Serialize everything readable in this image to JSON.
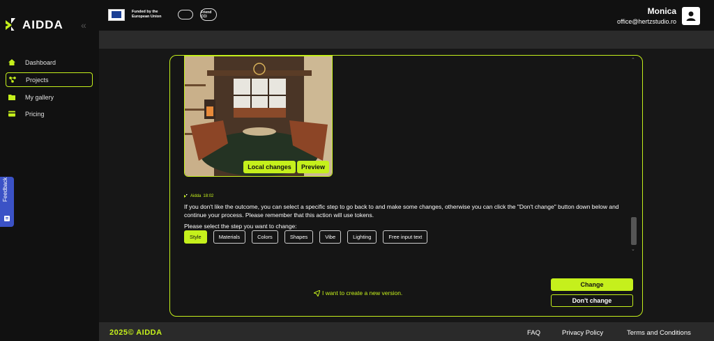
{
  "brand": {
    "name": "AIDDA",
    "accent": "#c5f01c"
  },
  "sponsors": {
    "eu_text": "Funded by the European Union",
    "cci_text": "Friend CCI"
  },
  "user": {
    "name": "Monica",
    "email": "office@hertzstudio.ro"
  },
  "sidebar": {
    "items": [
      {
        "label": "Dashboard",
        "icon": "home-icon",
        "active": false
      },
      {
        "label": "Projects",
        "icon": "projects-icon",
        "active": true
      },
      {
        "label": "My gallery",
        "icon": "folder-icon",
        "active": false
      },
      {
        "label": "Pricing",
        "icon": "pricing-icon",
        "active": false
      }
    ],
    "feedback_label": "Feedback"
  },
  "chat": {
    "image_buttons": {
      "local_changes": "Local changes",
      "preview": "Preview"
    },
    "message": {
      "sender": "Aidda",
      "time": "18:02",
      "body": "If you don't like the outcome, you can select a specific step to go back to and make some changes, otherwise you can click the \"Don't change\" button down below and continue your process. Please remember that this action will use tokens.",
      "prompt": "Please select the step you want to change:"
    },
    "steps": [
      "Style",
      "Materials",
      "Colors",
      "Shapes",
      "Vibe",
      "Lighting",
      "Free input text"
    ],
    "selected_step": "Style"
  },
  "actions": {
    "new_version": "I want to create a new version.",
    "change": "Change",
    "dont_change": "Don't change"
  },
  "footer": {
    "copyright": "2025© AIDDA",
    "links": [
      "FAQ",
      "Privacy Policy",
      "Terms and Conditions"
    ]
  }
}
